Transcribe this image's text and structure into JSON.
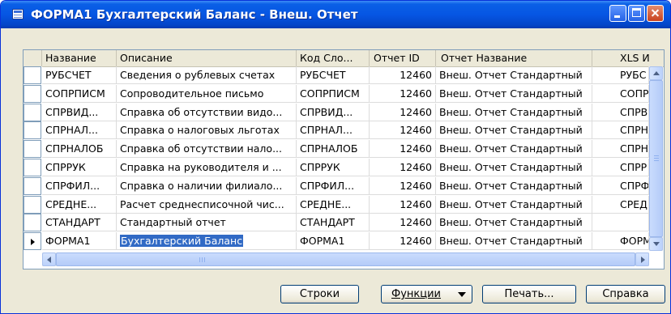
{
  "window": {
    "title": "ФОРМА1 Бухгалтерский Баланс - Внеш. Отчет",
    "title_icon": "form-icon"
  },
  "table": {
    "columns": [
      "Название",
      "Описание",
      "Код Сло...",
      "Отчет ID",
      "Отчет Название",
      "XLS И"
    ],
    "rows": [
      {
        "name": "РУБСЧЕТ",
        "desc": "Сведения о рублевых счетах",
        "code": "РУБСЧЕТ",
        "id": "12460",
        "report": "Внеш. Отчет Стандартный",
        "xls": "РУБС"
      },
      {
        "name": "СОПРПИСМ",
        "desc": "Сопроводительное письмо",
        "code": "СОПРПИСМ",
        "id": "12460",
        "report": "Внеш. Отчет Стандартный",
        "xls": "СОПР"
      },
      {
        "name": "СПРВИД...",
        "desc": "Справка об отсутствии видо...",
        "code": "СПРВИД...",
        "id": "12460",
        "report": "Внеш. Отчет Стандартный",
        "xls": "СПРВ"
      },
      {
        "name": "СПРНАЛ...",
        "desc": "Справка о налоговых льготах",
        "code": "СПРНАЛ...",
        "id": "12460",
        "report": "Внеш. Отчет Стандартный",
        "xls": "СПРН"
      },
      {
        "name": "СПРНАЛОБ",
        "desc": "Справка об отсутствии нало...",
        "code": "СПРНАЛОБ",
        "id": "12460",
        "report": "Внеш. Отчет Стандартный",
        "xls": "СПРН"
      },
      {
        "name": "СПРРУК",
        "desc": "Справка на руководителя и ...",
        "code": "СПРРУК",
        "id": "12460",
        "report": "Внеш. Отчет Стандартный",
        "xls": "СПРР"
      },
      {
        "name": "СПРФИЛ...",
        "desc": "Справка о наличии филиало...",
        "code": "СПРФИЛ...",
        "id": "12460",
        "report": "Внеш. Отчет Стандартный",
        "xls": "СПРФ"
      },
      {
        "name": "СРЕДНЕ...",
        "desc": "Расчет среднесписочной чис...",
        "code": "СРЕДНЕ...",
        "id": "12460",
        "report": "Внеш. Отчет Стандартный",
        "xls": "СРЕД"
      },
      {
        "name": "СТАНДАРТ",
        "desc": "Стандартный отчет",
        "code": "СТАНДАРТ",
        "id": "12460",
        "report": "Внеш. Отчет Стандартный",
        "xls": ""
      },
      {
        "name": "ФОРМА1",
        "desc": "Бухгалтерский Баланс",
        "code": "ФОРМА1",
        "id": "12460",
        "report": "Внеш. Отчет Стандартный",
        "xls": "ФОРМ"
      }
    ],
    "selected_row": 9
  },
  "buttons": {
    "rows": "Строки",
    "functions": "Функции",
    "print": "Печать...",
    "help": "Справка"
  },
  "colors": {
    "titlebar": "#0656e3",
    "selection": "#316ac5"
  }
}
